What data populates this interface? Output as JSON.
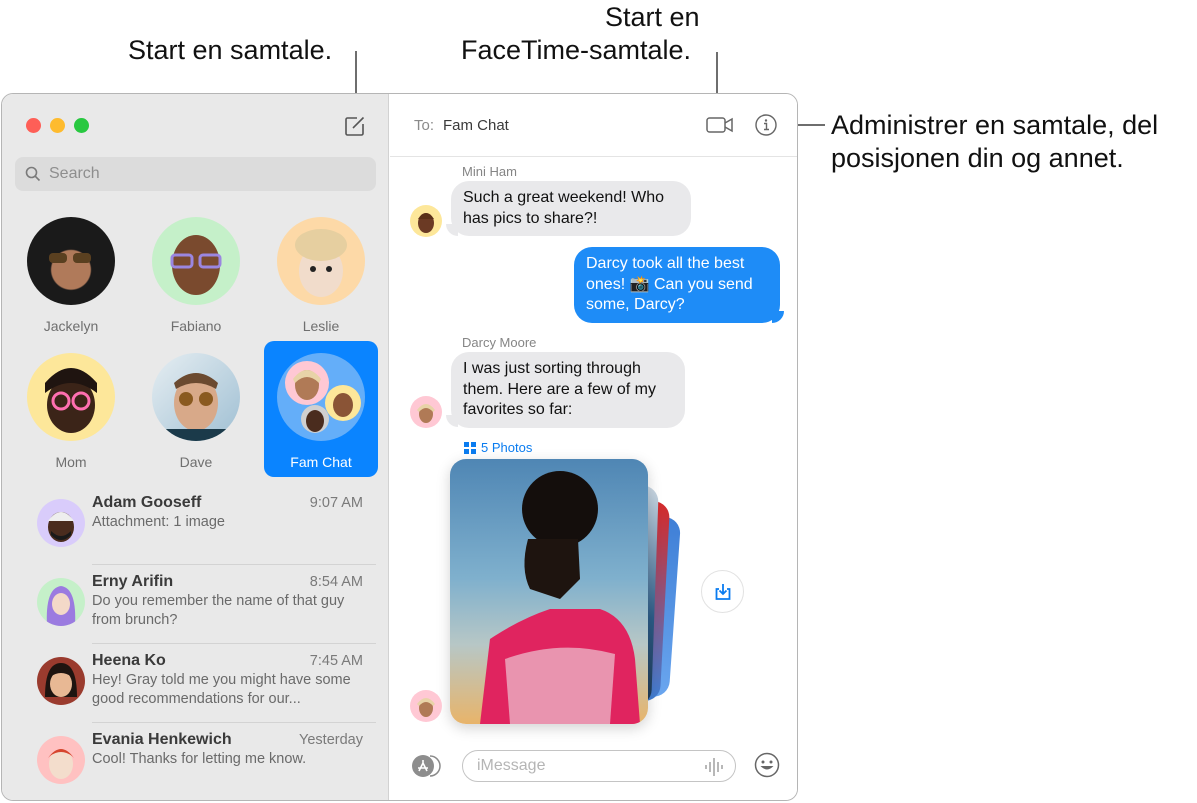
{
  "callouts": {
    "compose": "Start en samtale.",
    "facetime_line1": "Start en",
    "facetime_line2": "FaceTime-samtale.",
    "details_line1": "Administrer en samtale, del",
    "details_line2": "posisjonen din og annet."
  },
  "window": {
    "traffic_lights": {
      "close": "#fe5f57",
      "minimize": "#febb2e",
      "zoom": "#28c840"
    },
    "compose_icon": "compose-icon"
  },
  "sidebar": {
    "search": {
      "placeholder": "Search",
      "value": ""
    },
    "pinned": [
      {
        "name": "Jackelyn",
        "avatar_bg": "#2a2a2a",
        "selected": false
      },
      {
        "name": "Fabiano",
        "avatar_bg": "#c5f0c9",
        "selected": false
      },
      {
        "name": "Leslie",
        "avatar_bg": "#fdd9a7",
        "selected": false
      },
      {
        "name": "Mom",
        "avatar_bg": "#fde79a",
        "selected": false
      },
      {
        "name": "Dave",
        "avatar_bg": "#cfe3ee",
        "selected": false
      },
      {
        "name": "Fam Chat",
        "avatar_bg": "#64aef9",
        "selected": true
      }
    ],
    "conversations": [
      {
        "name": "Adam Gooseff",
        "time": "9:07 AM",
        "preview": "Attachment: 1 image",
        "avatar_bg": "#d9ccfb"
      },
      {
        "name": "Erny Arifin",
        "time": "8:54 AM",
        "preview": "Do you remember the name of that guy from brunch?",
        "avatar_bg": "#c5f0c9"
      },
      {
        "name": "Heena Ko",
        "time": "7:45 AM",
        "preview": "Hey! Gray told me you might have some good recommendations for our...",
        "avatar_bg": "#9a3b2e"
      },
      {
        "name": "Evania Henkewich",
        "time": "Yesterday",
        "preview": "Cool! Thanks for letting me know.",
        "avatar_bg": "#ffc1c1"
      }
    ]
  },
  "chat": {
    "to_label": "To:",
    "to_value": "Fam Chat",
    "messages": [
      {
        "sender": "Mini Ham",
        "direction": "incoming",
        "text": "Such a great weekend! Who has pics to share?!"
      },
      {
        "sender": "",
        "direction": "outgoing",
        "text": "Darcy took all the best ones! 📸 Can you send some, Darcy?"
      },
      {
        "sender": "Darcy Moore",
        "direction": "incoming",
        "text": "I was just sorting through them. Here are a few of my favorites so far:"
      }
    ],
    "photos_label": "5 Photos",
    "photo_count": 5,
    "input": {
      "placeholder": "iMessage",
      "value": ""
    },
    "accent_color": "#1e8cf7"
  }
}
